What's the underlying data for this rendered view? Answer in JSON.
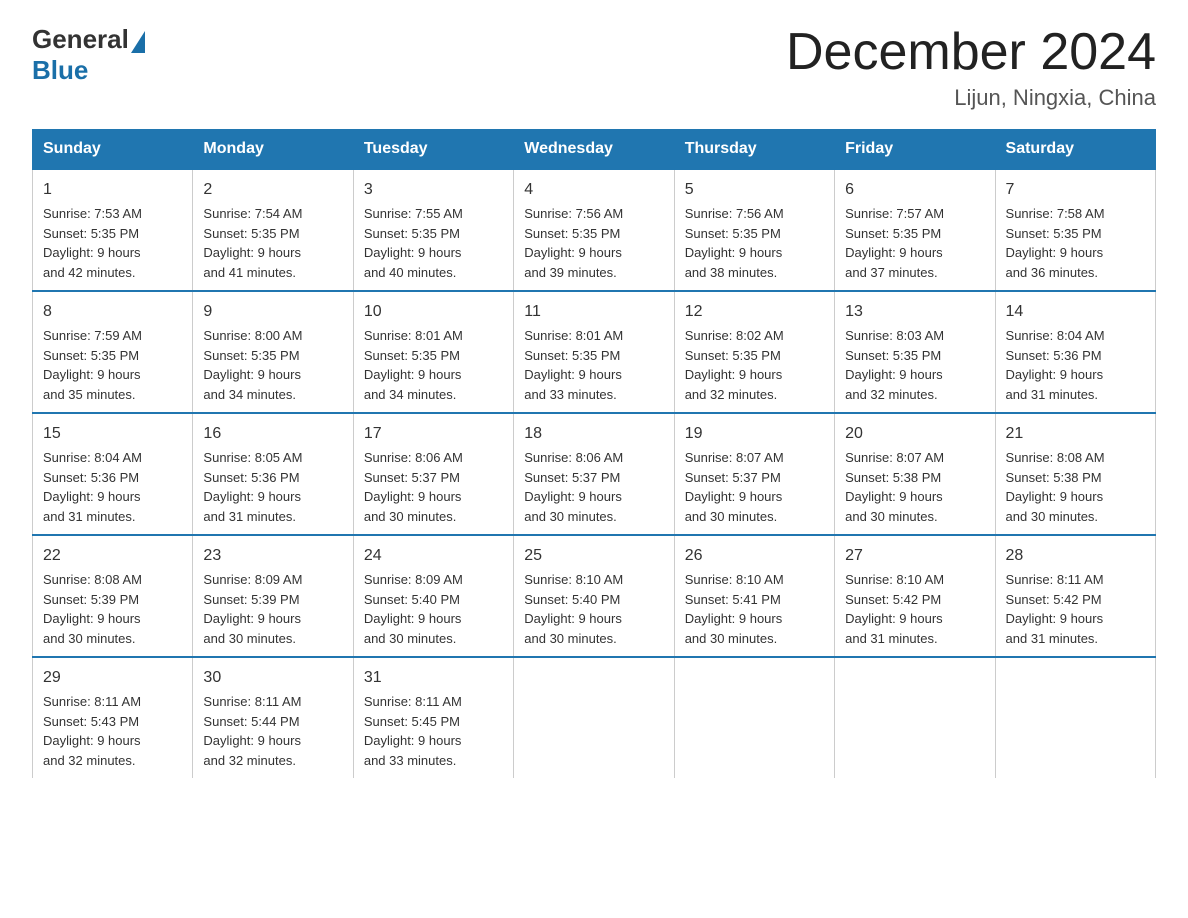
{
  "logo": {
    "general": "General",
    "blue": "Blue"
  },
  "title": "December 2024",
  "location": "Lijun, Ningxia, China",
  "weekdays": [
    "Sunday",
    "Monday",
    "Tuesday",
    "Wednesday",
    "Thursday",
    "Friday",
    "Saturday"
  ],
  "weeks": [
    [
      {
        "day": "1",
        "sunrise": "7:53 AM",
        "sunset": "5:35 PM",
        "daylight": "9 hours and 42 minutes."
      },
      {
        "day": "2",
        "sunrise": "7:54 AM",
        "sunset": "5:35 PM",
        "daylight": "9 hours and 41 minutes."
      },
      {
        "day": "3",
        "sunrise": "7:55 AM",
        "sunset": "5:35 PM",
        "daylight": "9 hours and 40 minutes."
      },
      {
        "day": "4",
        "sunrise": "7:56 AM",
        "sunset": "5:35 PM",
        "daylight": "9 hours and 39 minutes."
      },
      {
        "day": "5",
        "sunrise": "7:56 AM",
        "sunset": "5:35 PM",
        "daylight": "9 hours and 38 minutes."
      },
      {
        "day": "6",
        "sunrise": "7:57 AM",
        "sunset": "5:35 PM",
        "daylight": "9 hours and 37 minutes."
      },
      {
        "day": "7",
        "sunrise": "7:58 AM",
        "sunset": "5:35 PM",
        "daylight": "9 hours and 36 minutes."
      }
    ],
    [
      {
        "day": "8",
        "sunrise": "7:59 AM",
        "sunset": "5:35 PM",
        "daylight": "9 hours and 35 minutes."
      },
      {
        "day": "9",
        "sunrise": "8:00 AM",
        "sunset": "5:35 PM",
        "daylight": "9 hours and 34 minutes."
      },
      {
        "day": "10",
        "sunrise": "8:01 AM",
        "sunset": "5:35 PM",
        "daylight": "9 hours and 34 minutes."
      },
      {
        "day": "11",
        "sunrise": "8:01 AM",
        "sunset": "5:35 PM",
        "daylight": "9 hours and 33 minutes."
      },
      {
        "day": "12",
        "sunrise": "8:02 AM",
        "sunset": "5:35 PM",
        "daylight": "9 hours and 32 minutes."
      },
      {
        "day": "13",
        "sunrise": "8:03 AM",
        "sunset": "5:35 PM",
        "daylight": "9 hours and 32 minutes."
      },
      {
        "day": "14",
        "sunrise": "8:04 AM",
        "sunset": "5:36 PM",
        "daylight": "9 hours and 31 minutes."
      }
    ],
    [
      {
        "day": "15",
        "sunrise": "8:04 AM",
        "sunset": "5:36 PM",
        "daylight": "9 hours and 31 minutes."
      },
      {
        "day": "16",
        "sunrise": "8:05 AM",
        "sunset": "5:36 PM",
        "daylight": "9 hours and 31 minutes."
      },
      {
        "day": "17",
        "sunrise": "8:06 AM",
        "sunset": "5:37 PM",
        "daylight": "9 hours and 30 minutes."
      },
      {
        "day": "18",
        "sunrise": "8:06 AM",
        "sunset": "5:37 PM",
        "daylight": "9 hours and 30 minutes."
      },
      {
        "day": "19",
        "sunrise": "8:07 AM",
        "sunset": "5:37 PM",
        "daylight": "9 hours and 30 minutes."
      },
      {
        "day": "20",
        "sunrise": "8:07 AM",
        "sunset": "5:38 PM",
        "daylight": "9 hours and 30 minutes."
      },
      {
        "day": "21",
        "sunrise": "8:08 AM",
        "sunset": "5:38 PM",
        "daylight": "9 hours and 30 minutes."
      }
    ],
    [
      {
        "day": "22",
        "sunrise": "8:08 AM",
        "sunset": "5:39 PM",
        "daylight": "9 hours and 30 minutes."
      },
      {
        "day": "23",
        "sunrise": "8:09 AM",
        "sunset": "5:39 PM",
        "daylight": "9 hours and 30 minutes."
      },
      {
        "day": "24",
        "sunrise": "8:09 AM",
        "sunset": "5:40 PM",
        "daylight": "9 hours and 30 minutes."
      },
      {
        "day": "25",
        "sunrise": "8:10 AM",
        "sunset": "5:40 PM",
        "daylight": "9 hours and 30 minutes."
      },
      {
        "day": "26",
        "sunrise": "8:10 AM",
        "sunset": "5:41 PM",
        "daylight": "9 hours and 30 minutes."
      },
      {
        "day": "27",
        "sunrise": "8:10 AM",
        "sunset": "5:42 PM",
        "daylight": "9 hours and 31 minutes."
      },
      {
        "day": "28",
        "sunrise": "8:11 AM",
        "sunset": "5:42 PM",
        "daylight": "9 hours and 31 minutes."
      }
    ],
    [
      {
        "day": "29",
        "sunrise": "8:11 AM",
        "sunset": "5:43 PM",
        "daylight": "9 hours and 32 minutes."
      },
      {
        "day": "30",
        "sunrise": "8:11 AM",
        "sunset": "5:44 PM",
        "daylight": "9 hours and 32 minutes."
      },
      {
        "day": "31",
        "sunrise": "8:11 AM",
        "sunset": "5:45 PM",
        "daylight": "9 hours and 33 minutes."
      },
      null,
      null,
      null,
      null
    ]
  ],
  "labels": {
    "sunrise": "Sunrise:",
    "sunset": "Sunset:",
    "daylight": "Daylight:"
  }
}
